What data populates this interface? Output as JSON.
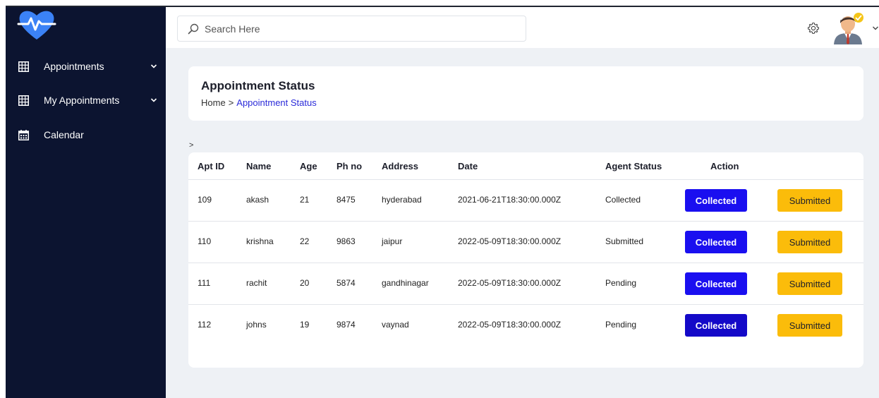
{
  "sidebar": {
    "items": [
      {
        "label": "Appointments",
        "icon": "grid-table-icon",
        "expandable": true
      },
      {
        "label": "My Appointments",
        "icon": "grid-table-icon",
        "expandable": true
      },
      {
        "label": "Calendar",
        "icon": "calendar-icon",
        "expandable": false
      }
    ]
  },
  "search": {
    "placeholder": "Search Here"
  },
  "header": {
    "title": "Appointment Status",
    "breadcrumb": {
      "home": "Home",
      "separator": ">",
      "current": "Appointment Status"
    }
  },
  "misc": {
    "gt": ">"
  },
  "table": {
    "columns": [
      "Apt ID",
      "Name",
      "Age",
      "Ph no",
      "Address",
      "Date",
      "Agent Status",
      "Action"
    ],
    "rows": [
      {
        "id": "109",
        "name": "akash",
        "age": "21",
        "phone": "8475",
        "address": "hyderabad",
        "date": "2021-06-21T18:30:00.000Z",
        "agent_status": "Collected",
        "btn_collected": "Collected",
        "btn_submitted": "Submitted"
      },
      {
        "id": "110",
        "name": "krishna",
        "age": "22",
        "phone": "9863",
        "address": "jaipur",
        "date": "2022-05-09T18:30:00.000Z",
        "agent_status": "Submitted",
        "btn_collected": "Collected",
        "btn_submitted": "Submitted"
      },
      {
        "id": "111",
        "name": "rachit",
        "age": "20",
        "phone": "5874",
        "address": "gandhinagar",
        "date": "2022-05-09T18:30:00.000Z",
        "agent_status": "Pending",
        "btn_collected": "Collected",
        "btn_submitted": "Submitted"
      },
      {
        "id": "112",
        "name": "johns",
        "age": "19",
        "phone": "9874",
        "address": "vaynad",
        "date": "2022-05-09T18:30:00.000Z",
        "agent_status": "Pending",
        "btn_collected": "Collected",
        "btn_submitted": "Submitted"
      }
    ]
  },
  "colors": {
    "sidebar_bg": "#0c1430",
    "collected_button": "#1a0ff0",
    "submitted_button": "#fbbc0a",
    "breadcrumb_link": "#2b2bd9",
    "page_bg": "#eef1f5"
  }
}
